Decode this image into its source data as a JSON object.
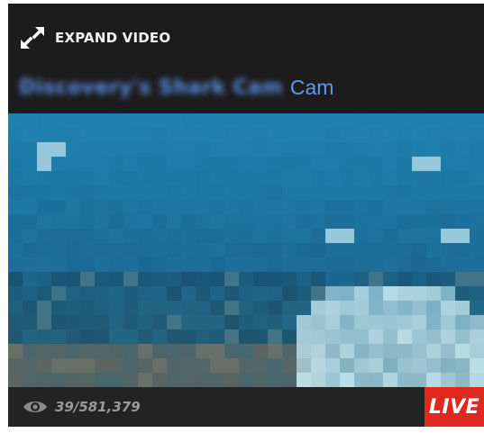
{
  "player": {
    "expand_label": "EXPAND VIDEO",
    "title_obscured": "Discovery's Shark Cam",
    "title_suffix": "Cam",
    "viewer_count": "39/581,379",
    "live_label": "LIVE"
  },
  "icons": {
    "expand": "expand-arrows-icon",
    "viewers": "eye-icon"
  },
  "colors": {
    "background": "#1c1c1c",
    "title_link": "#5a9cf0",
    "live_badge": "#e0281e",
    "viewer_text": "#9a9a9a"
  }
}
